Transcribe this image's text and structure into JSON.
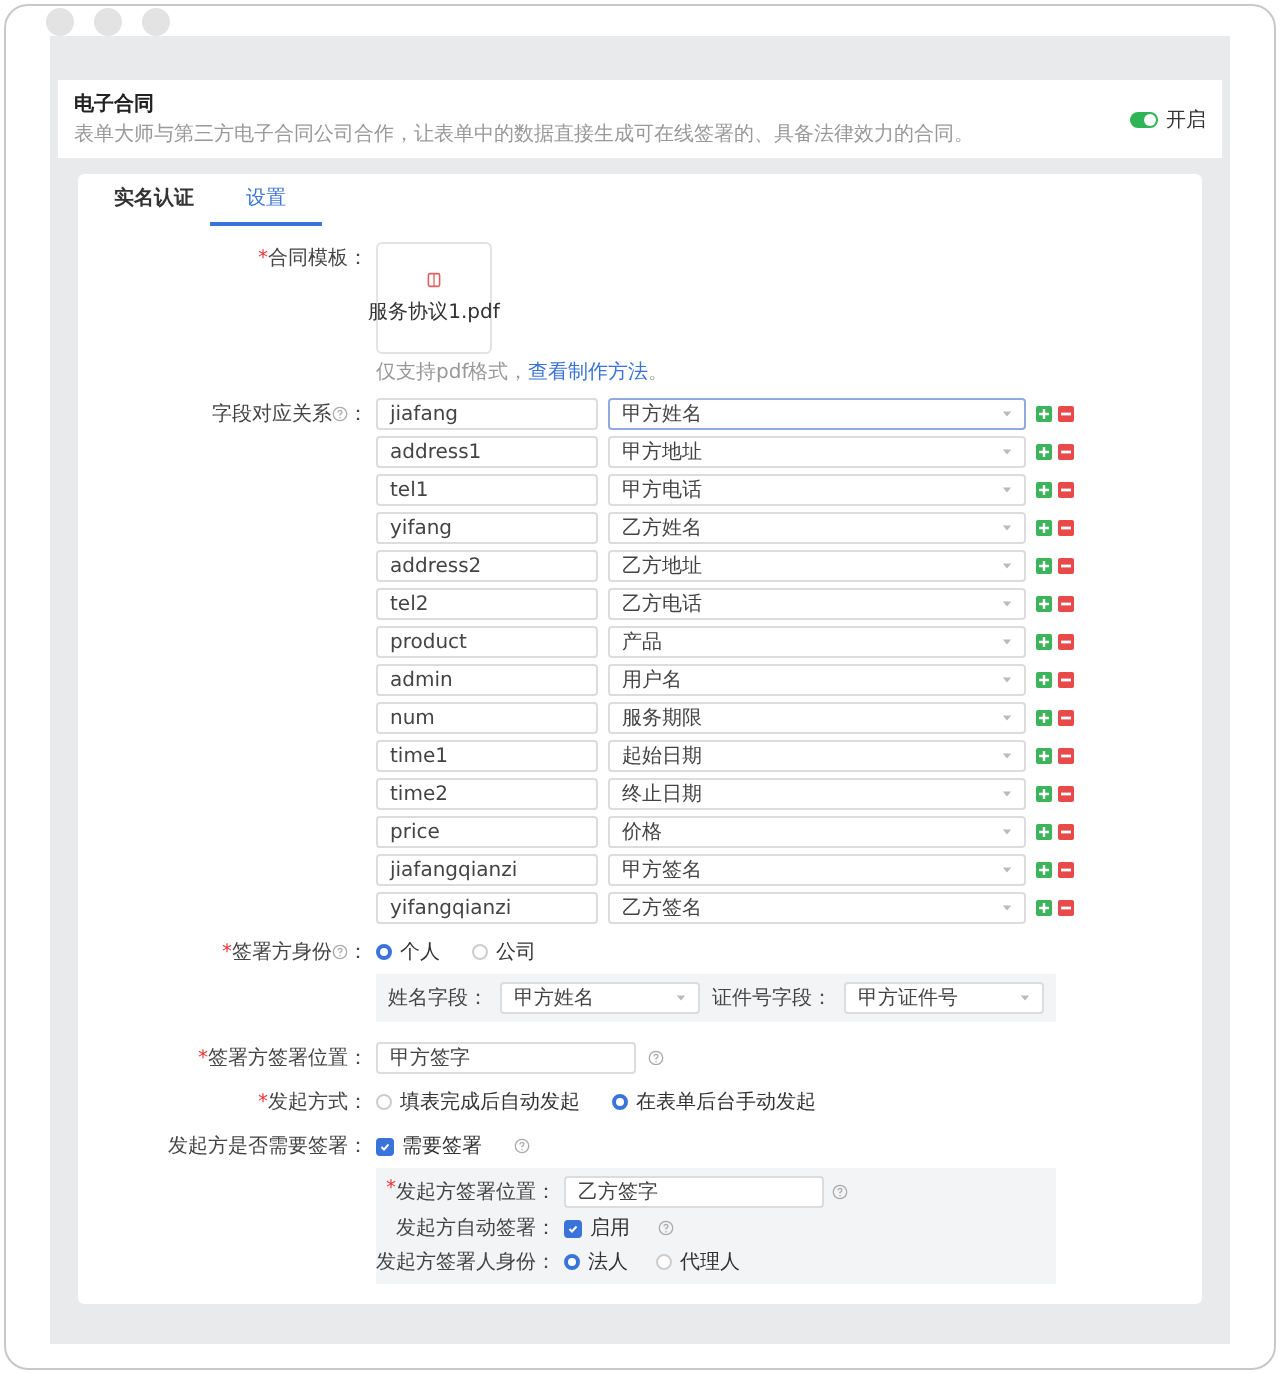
{
  "header": {
    "title": "电子合同",
    "description": "表单大师与第三方电子合同公司合作，让表单中的数据直接生成可在线签署的、具备法律效力的合同。",
    "toggle": {
      "on": true,
      "label": "开启"
    }
  },
  "tabs": [
    {
      "label": "实名认证",
      "selected": false
    },
    {
      "label": "设置",
      "selected": true
    }
  ],
  "template": {
    "required_mark": "*",
    "label": "合同模板：",
    "file_name": "服务协议1.pdf",
    "hint": "仅支持pdf格式，",
    "link": "查看制作方法",
    "hint_end": "。"
  },
  "mapping": {
    "label": "字段对应关系",
    "colon": "：",
    "rows": [
      {
        "field": "jiafang",
        "value": "甲方姓名",
        "focused": true
      },
      {
        "field": "address1",
        "value": "甲方地址",
        "focused": false
      },
      {
        "field": "tel1",
        "value": "甲方电话",
        "focused": false
      },
      {
        "field": "yifang",
        "value": "乙方姓名",
        "focused": false
      },
      {
        "field": "address2",
        "value": "乙方地址",
        "focused": false
      },
      {
        "field": "tel2",
        "value": "乙方电话",
        "focused": false
      },
      {
        "field": "product",
        "value": "产品",
        "focused": false
      },
      {
        "field": "admin",
        "value": "用户名",
        "focused": false
      },
      {
        "field": "num",
        "value": "服务期限",
        "focused": false
      },
      {
        "field": "time1",
        "value": "起始日期",
        "focused": false
      },
      {
        "field": "time2",
        "value": "终止日期",
        "focused": false
      },
      {
        "field": "price",
        "value": "价格",
        "focused": false
      },
      {
        "field": "jiafangqianzi",
        "value": "甲方签名",
        "focused": false
      },
      {
        "field": "yifangqianzi",
        "value": "乙方签名",
        "focused": false
      }
    ]
  },
  "signer_identity": {
    "required_mark": "*",
    "label": "签署方身份",
    "colon": "：",
    "options": [
      {
        "label": "个人",
        "selected": true
      },
      {
        "label": "公司",
        "selected": false
      }
    ],
    "name_field": {
      "label": "姓名字段：",
      "value": "甲方姓名"
    },
    "id_field": {
      "label": "证件号字段：",
      "value": "甲方证件号"
    }
  },
  "sign_position": {
    "required_mark": "*",
    "label": "签署方签署位置：",
    "value": "甲方签字"
  },
  "launch_mode": {
    "required_mark": "*",
    "label": "发起方式：",
    "options": [
      {
        "label": "填表完成后自动发起",
        "selected": false
      },
      {
        "label": "在表单后台手动发起",
        "selected": true
      }
    ]
  },
  "initiator_sign": {
    "label": "发起方是否需要签署：",
    "checkbox": {
      "label": "需要签署",
      "checked": true
    },
    "position": {
      "required_mark": "*",
      "label": "发起方签署位置：",
      "value": "乙方签字"
    },
    "auto_sign": {
      "label": "发起方自动签署：",
      "checkbox": {
        "label": "启用",
        "checked": true
      }
    },
    "identity": {
      "label": "发起方签署人身份：",
      "options": [
        {
          "label": "法人",
          "selected": true
        },
        {
          "label": "代理人",
          "selected": false
        }
      ]
    }
  }
}
